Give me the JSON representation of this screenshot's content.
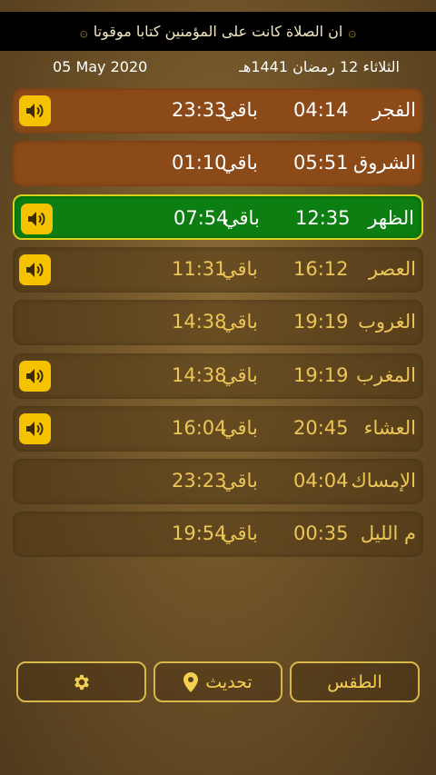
{
  "banner": {
    "text": "ان الصلاة كانت على المؤمنين كتابا موقوتا",
    "ornament_icon": "ornament-icon"
  },
  "dates": {
    "gregorian": "05 May 2020",
    "hijri": "الثلاثاء 12 رمضان 1441هـ"
  },
  "prayers": [
    {
      "name": "الفجر",
      "time": "04:14",
      "baqi": "باقي",
      "remaining": "23:33",
      "state": "past",
      "sound": true
    },
    {
      "name": "الشروق",
      "time": "05:51",
      "baqi": "باقي",
      "remaining": "01:10",
      "state": "past",
      "sound": false
    },
    {
      "name": "الظهر",
      "time": "12:35",
      "baqi": "باقي",
      "remaining": "07:54",
      "state": "current",
      "sound": true
    },
    {
      "name": "العصر",
      "time": "16:12",
      "baqi": "باقي",
      "remaining": "11:31",
      "state": "upcoming",
      "sound": true
    },
    {
      "name": "الغروب",
      "time": "19:19",
      "baqi": "باقي",
      "remaining": "14:38",
      "state": "upcoming",
      "sound": false
    },
    {
      "name": "المغرب",
      "time": "19:19",
      "baqi": "باقي",
      "remaining": "14:38",
      "state": "upcoming",
      "sound": true
    },
    {
      "name": "العشاء",
      "time": "20:45",
      "baqi": "باقي",
      "remaining": "16:04",
      "state": "upcoming",
      "sound": true
    },
    {
      "name": "الإمساك",
      "time": "04:04",
      "baqi": "باقي",
      "remaining": "23:23",
      "state": "upcoming",
      "sound": false
    },
    {
      "name": "م الليل",
      "time": "00:35",
      "baqi": "باقي",
      "remaining": "19:54",
      "state": "upcoming",
      "sound": false
    }
  ],
  "buttons": {
    "weather_label": "الطقس",
    "update_label": "تحديث",
    "update_icon": "location-pin-icon",
    "settings_icon": "gear-icon"
  },
  "colors": {
    "past_row": "#8c4a18",
    "current_row": "#0d7f12",
    "current_border": "#d9d21a",
    "accent_gold": "#ecc655",
    "speaker_bg": "#f5c200"
  }
}
